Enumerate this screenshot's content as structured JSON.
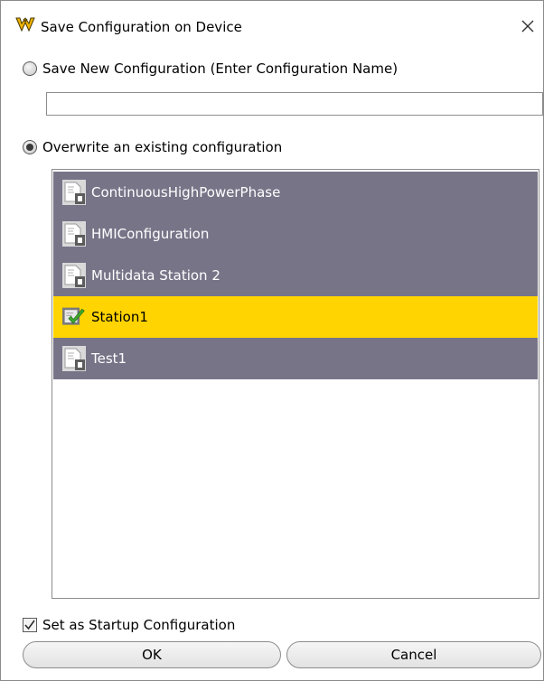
{
  "dialog": {
    "title": "Save Configuration on Device",
    "app_icon": "vendor-logo-icon",
    "close_icon": "close-icon"
  },
  "save_new": {
    "label": "Save New Configuration (Enter Configuration Name)",
    "selected": false,
    "name_input": {
      "value": "",
      "placeholder": ""
    }
  },
  "overwrite": {
    "label": "Overwrite an existing configuration",
    "selected": true,
    "items": [
      {
        "label": "ContinuousHighPowerPhase",
        "icon": "document-icon",
        "selected": false
      },
      {
        "label": "HMIConfiguration",
        "icon": "document-icon",
        "selected": false
      },
      {
        "label": "Multidata Station 2",
        "icon": "document-icon",
        "selected": false
      },
      {
        "label": "Station1",
        "icon": "active-config-check-icon",
        "selected": true
      },
      {
        "label": "Test1",
        "icon": "document-icon",
        "selected": false
      }
    ]
  },
  "startup": {
    "label": "Set as Startup Configuration",
    "checked": true
  },
  "buttons": {
    "ok_label": "OK",
    "cancel_label": "Cancel"
  },
  "colors": {
    "item_background": "#787488",
    "selected_background": "#ffd400",
    "accent_logo": "#f0b400"
  }
}
